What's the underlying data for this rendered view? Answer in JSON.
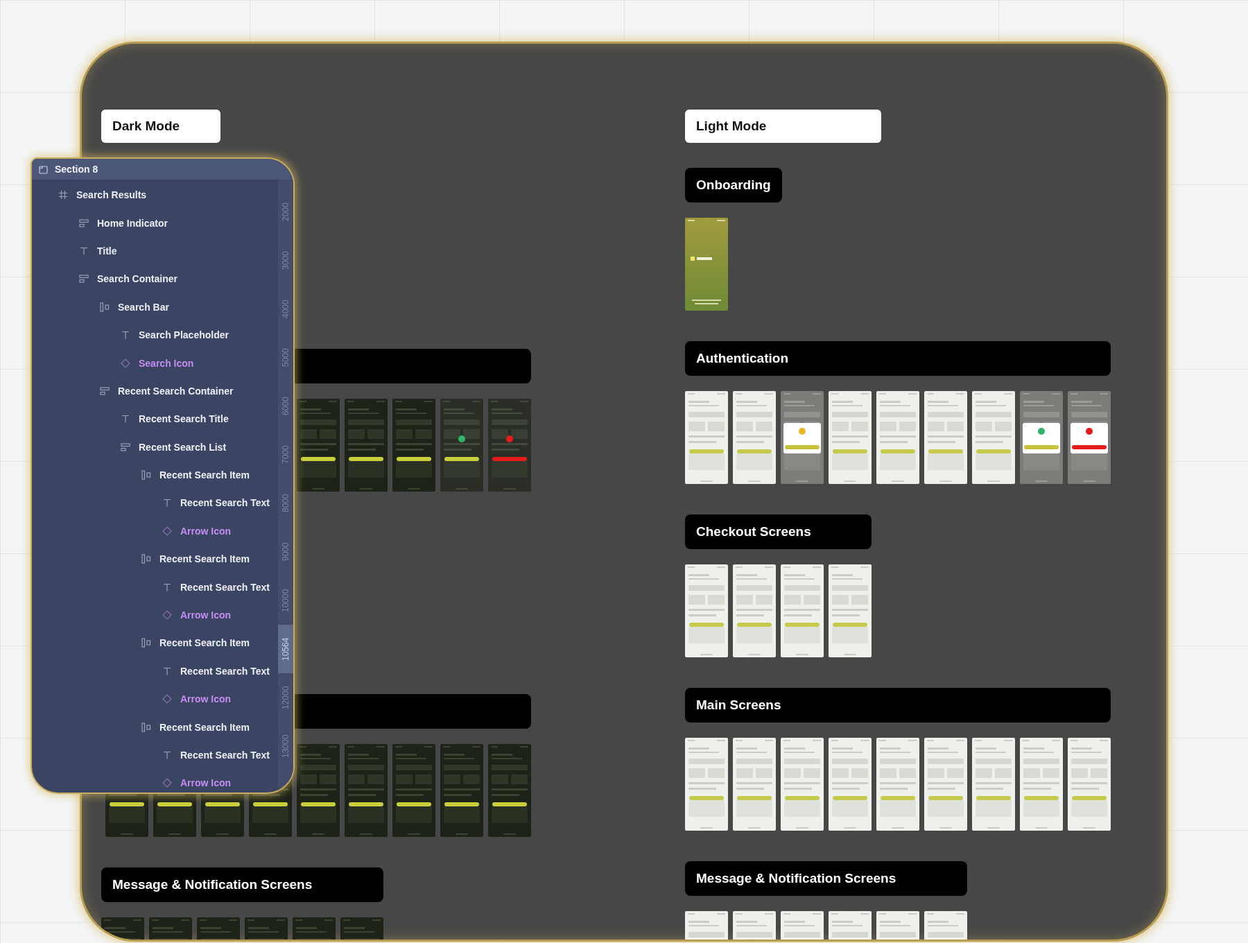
{
  "canvas": {
    "left": {
      "label": "Dark Mode",
      "sections": [
        {
          "thumbnails": [
            {
              "kind": "dark"
            },
            {
              "kind": "dark"
            },
            {
              "kind": "dark"
            },
            {
              "kind": "dark-success"
            },
            {
              "kind": "dark-error"
            }
          ]
        },
        {
          "thumbnails": [
            {
              "kind": "dark"
            },
            {
              "kind": "dark"
            },
            {
              "kind": "dark"
            },
            {
              "kind": "dark"
            },
            {
              "kind": "dark"
            },
            {
              "kind": "dark"
            },
            {
              "kind": "dark"
            },
            {
              "kind": "dark"
            },
            {
              "kind": "dark"
            }
          ]
        },
        {
          "title": "Message & Notification  Screens",
          "thumbnails": [
            {
              "kind": "dark"
            },
            {
              "kind": "dark"
            },
            {
              "kind": "dark"
            },
            {
              "kind": "dark"
            },
            {
              "kind": "dark"
            },
            {
              "kind": "dark"
            }
          ]
        }
      ]
    },
    "right": {
      "label": "Light Mode",
      "sections": [
        {
          "title": "Onboarding",
          "thumbnails": [
            {
              "kind": "onboarding"
            }
          ]
        },
        {
          "title": "Authentication",
          "thumbnails": [
            {
              "kind": "light"
            },
            {
              "kind": "light"
            },
            {
              "kind": "light-dialog"
            },
            {
              "kind": "light"
            },
            {
              "kind": "light"
            },
            {
              "kind": "light"
            },
            {
              "kind": "light"
            },
            {
              "kind": "light-success"
            },
            {
              "kind": "light-error"
            }
          ]
        },
        {
          "title": "Checkout Screens",
          "thumbnails": [
            {
              "kind": "light"
            },
            {
              "kind": "light"
            },
            {
              "kind": "light"
            },
            {
              "kind": "light"
            }
          ]
        },
        {
          "title": "Main Screens",
          "thumbnails": [
            {
              "kind": "light"
            },
            {
              "kind": "light"
            },
            {
              "kind": "light"
            },
            {
              "kind": "light"
            },
            {
              "kind": "light"
            },
            {
              "kind": "light"
            },
            {
              "kind": "light"
            },
            {
              "kind": "light"
            },
            {
              "kind": "light"
            }
          ]
        },
        {
          "title": "Message & Notification  Screens",
          "thumbnails": [
            {
              "kind": "light"
            },
            {
              "kind": "light"
            },
            {
              "kind": "light"
            },
            {
              "kind": "light"
            },
            {
              "kind": "light"
            },
            {
              "kind": "light"
            }
          ]
        }
      ]
    }
  },
  "layers_panel": {
    "title": "Section 8",
    "items": [
      {
        "label": "Search Results",
        "kind": "frame",
        "children": [
          {
            "label": "Home Indicator",
            "kind": "stack"
          },
          {
            "label": "Title",
            "kind": "text"
          },
          {
            "label": "Search Container",
            "kind": "stack",
            "children": [
              {
                "label": "Search Bar",
                "kind": "row",
                "children": [
                  {
                    "label": "Search Placeholder",
                    "kind": "text"
                  },
                  {
                    "label": "Search Icon",
                    "kind": "component"
                  }
                ]
              },
              {
                "label": "Recent Search Container",
                "kind": "stack",
                "children": [
                  {
                    "label": "Recent Search Title",
                    "kind": "text"
                  },
                  {
                    "label": "Recent Search List",
                    "kind": "stack",
                    "children": [
                      {
                        "label": "Recent Search Item",
                        "kind": "row",
                        "children": [
                          {
                            "label": "Recent Search Text",
                            "kind": "text"
                          },
                          {
                            "label": "Arrow Icon",
                            "kind": "component"
                          }
                        ]
                      },
                      {
                        "label": "Recent Search Item",
                        "kind": "row",
                        "children": [
                          {
                            "label": "Recent Search Text",
                            "kind": "text"
                          },
                          {
                            "label": "Arrow Icon",
                            "kind": "component"
                          }
                        ]
                      },
                      {
                        "label": "Recent Search Item",
                        "kind": "row",
                        "children": [
                          {
                            "label": "Recent Search Text",
                            "kind": "text"
                          },
                          {
                            "label": "Arrow Icon",
                            "kind": "component"
                          }
                        ]
                      },
                      {
                        "label": "Recent Search Item",
                        "kind": "row",
                        "children": [
                          {
                            "label": "Recent Search Text",
                            "kind": "text"
                          },
                          {
                            "label": "Arrow Icon",
                            "kind": "component"
                          }
                        ]
                      }
                    ]
                  }
                ]
              }
            ]
          }
        ]
      }
    ],
    "ruler": [
      {
        "label": "2000",
        "selected": false
      },
      {
        "label": "3000",
        "selected": false
      },
      {
        "label": "4000",
        "selected": false
      },
      {
        "label": "5000",
        "selected": false
      },
      {
        "label": "6000",
        "selected": false
      },
      {
        "label": "7000",
        "selected": false
      },
      {
        "label": "8000",
        "selected": false
      },
      {
        "label": "9000",
        "selected": false
      },
      {
        "label": "10000",
        "selected": false
      },
      {
        "label": "10564",
        "selected": true
      },
      {
        "label": "12000",
        "selected": false
      },
      {
        "label": "13000",
        "selected": false
      }
    ]
  }
}
